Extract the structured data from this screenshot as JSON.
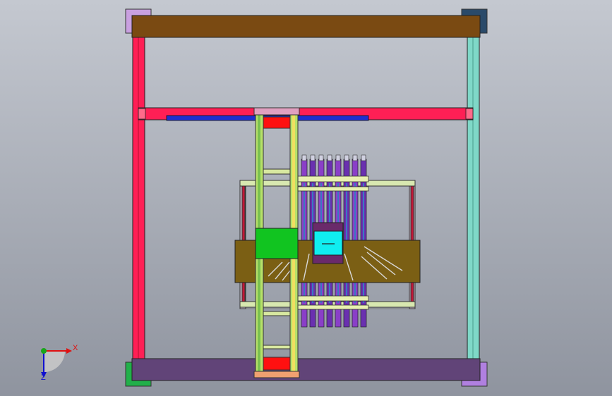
{
  "viewport": {
    "background_top": "#c4c8d0",
    "background_bottom": "#8f949f"
  },
  "triad": {
    "x_label": "X",
    "z_label": "Z",
    "x_color": "#e01010",
    "y_color": "#19a619",
    "z_color": "#1010d0"
  },
  "model": {
    "top_beam_color": "#7a4a12",
    "bottom_beam_color": "#614478",
    "left_post_color": "#ff1f55",
    "right_post_color": "#7fd8c8",
    "cross_beam_color": "#ff1f55",
    "rail_color": "#1e2fd0",
    "carriage_color": "#b7e06a",
    "green_block_color": "#11c420",
    "cyan_block_color": "#10eef0",
    "plate_color": "#7b5f14",
    "rod_color": "#8a3fc8"
  }
}
